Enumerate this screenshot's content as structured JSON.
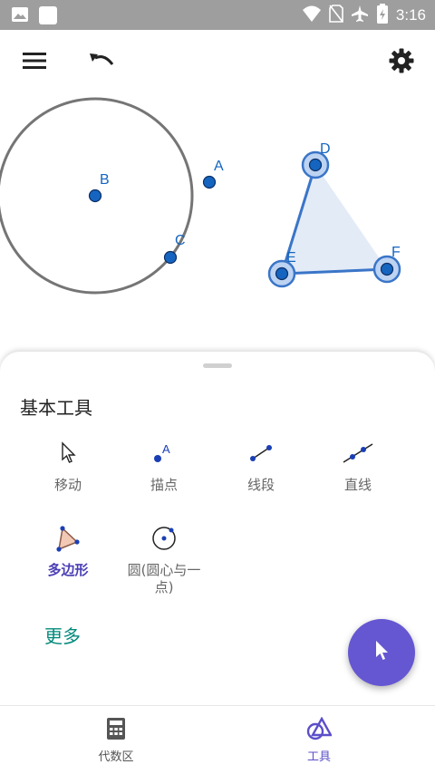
{
  "status_bar": {
    "time": "3:16"
  },
  "canvas": {
    "points": [
      "B",
      "A",
      "C",
      "D",
      "E",
      "F"
    ]
  },
  "tools_panel": {
    "title": "基本工具",
    "tools": [
      {
        "label": "移动",
        "icon": "cursor-icon"
      },
      {
        "label": "描点",
        "icon": "point-icon"
      },
      {
        "label": "线段",
        "icon": "segment-icon"
      },
      {
        "label": "直线",
        "icon": "line-icon"
      },
      {
        "label": "多边形",
        "icon": "polygon-icon",
        "active": true
      },
      {
        "label": "圆(圆心与一点)",
        "icon": "circle-icon"
      }
    ],
    "more_label": "更多"
  },
  "bottom_nav": {
    "algebra_label": "代数区",
    "tools_label": "工具"
  },
  "colors": {
    "accent": "#6557d2",
    "point": "#1565c0",
    "teal": "#00897b",
    "statusbar": "#9e9e9e"
  }
}
